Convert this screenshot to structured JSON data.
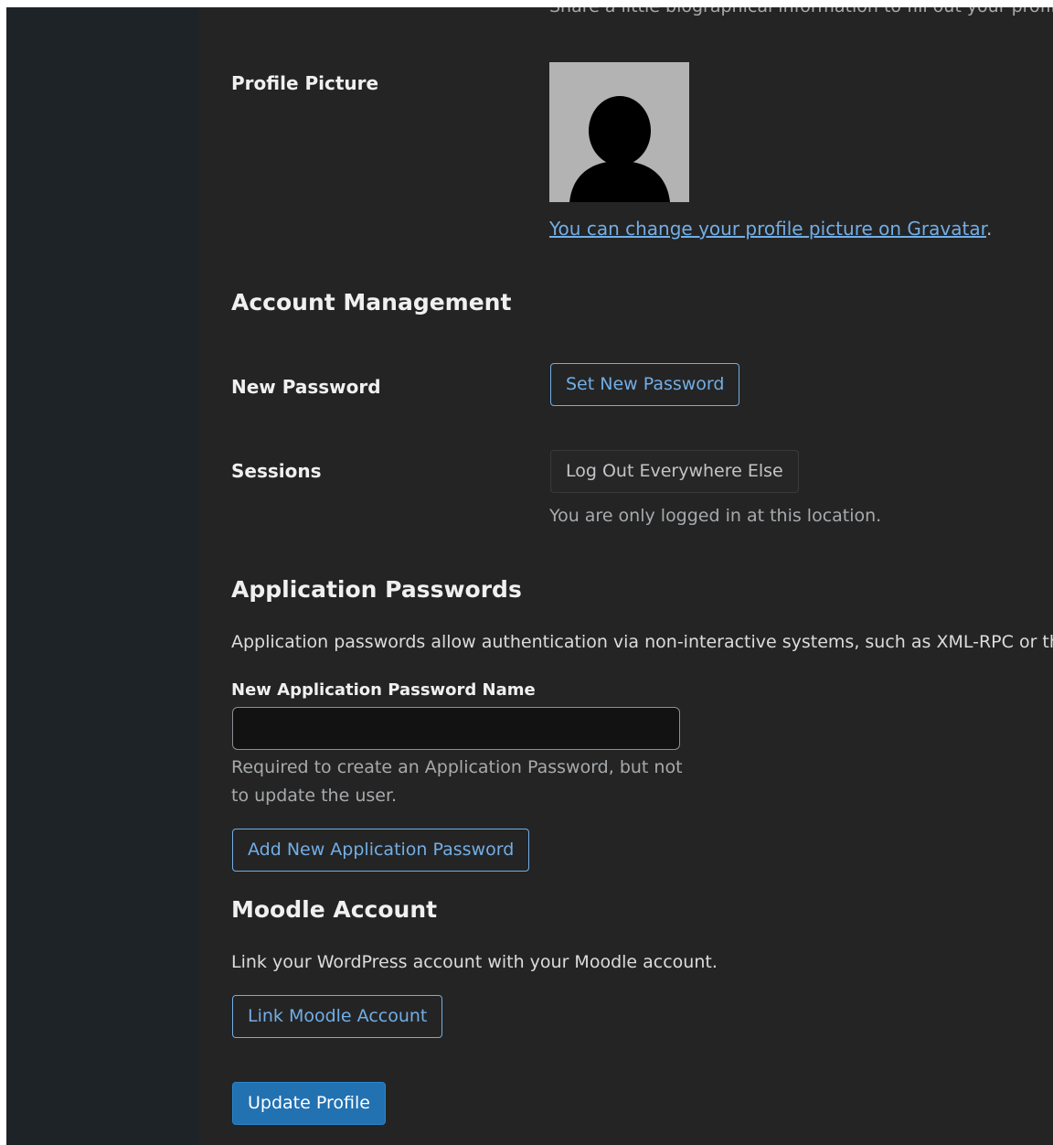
{
  "bio": {
    "description": "Share a little biographical information to fill out your profile."
  },
  "profile_picture": {
    "label": "Profile Picture",
    "link_text": "You can change your profile picture on Gravatar",
    "link_suffix": "."
  },
  "account_management": {
    "title": "Account Management",
    "new_password": {
      "label": "New Password",
      "button": "Set New Password"
    },
    "sessions": {
      "label": "Sessions",
      "button": "Log Out Everywhere Else",
      "description": "You are only logged in at this location."
    }
  },
  "application_passwords": {
    "title": "Application Passwords",
    "description": "Application passwords allow authentication via non-interactive systems, such as XML-RPC or the REST API, without providing your actual password.",
    "name_label": "New Application Password Name",
    "name_value": "",
    "help_line1": "Required to create an Application Password, but not",
    "help_line2": "to update the user.",
    "add_button": "Add New Application Password"
  },
  "moodle": {
    "title": "Moodle Account",
    "description": "Link your WordPress account with your Moodle account.",
    "button": "Link Moodle Account"
  },
  "submit": {
    "button": "Update Profile"
  },
  "colors": {
    "sidebar": "#1d2327",
    "background": "#242424",
    "link": "#72aee6",
    "primary": "#2271b1"
  }
}
